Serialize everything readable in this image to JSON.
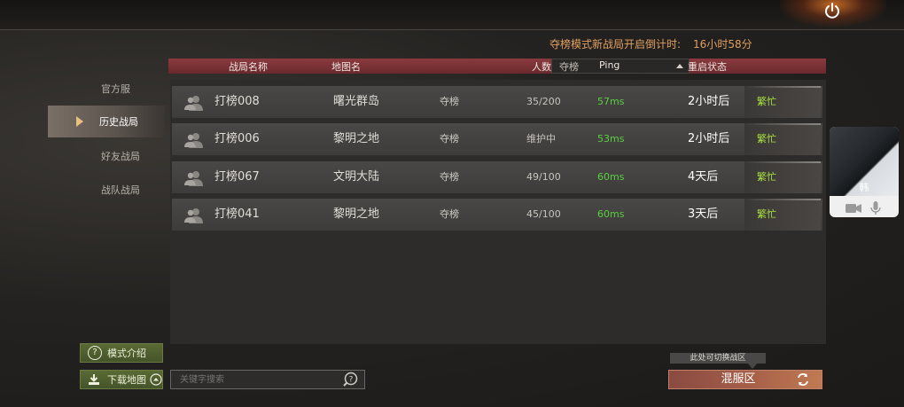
{
  "countdown": {
    "label": "夺榜模式新战局开启倒计时:",
    "value": "16小时58分"
  },
  "table_header": {
    "name": "战局名称",
    "map": "地图名",
    "mode_filter": "夺榜",
    "players": "人数",
    "ping": "Ping",
    "restart": "重启状态"
  },
  "sidebar": {
    "items": [
      {
        "label": "官方服",
        "active": false
      },
      {
        "label": "历史战局",
        "active": true
      },
      {
        "label": "好友战局",
        "active": false
      },
      {
        "label": "战队战局",
        "active": false
      }
    ]
  },
  "rows": [
    {
      "name": "打榜008",
      "map": "曙光群岛",
      "mode": "夺榜",
      "players": "35/200",
      "ping": "57ms",
      "restart": "2小时后",
      "status": "繁忙"
    },
    {
      "name": "打榜006",
      "map": "黎明之地",
      "mode": "夺榜",
      "players": "维护中",
      "ping": "53ms",
      "restart": "2小时后",
      "status": "繁忙"
    },
    {
      "name": "打榜067",
      "map": "文明大陆",
      "mode": "夺榜",
      "players": "49/100",
      "ping": "60ms",
      "restart": "4天后",
      "status": "繁忙"
    },
    {
      "name": "打榜041",
      "map": "黎明之地",
      "mode": "夺榜",
      "players": "45/100",
      "ping": "60ms",
      "restart": "3天后",
      "status": "繁忙"
    }
  ],
  "buttons": {
    "mode_intro": "模式介绍",
    "download_map": "下载地图",
    "server_zone": "混服区"
  },
  "search": {
    "placeholder": "关键字搜索"
  },
  "hint": "此处可切换战区",
  "video_call": {
    "name": "韩"
  },
  "colors": {
    "header_red": "#7a3236",
    "ping_green": "#58d040",
    "status_yellowgreen": "#a8e040",
    "countdown_orange": "#e0a060",
    "button_green": "#4e5e2e",
    "server_btn": "#a45e48"
  },
  "icons": [
    "power-icon",
    "user-icon",
    "question-icon",
    "download-icon",
    "up-arrow-icon",
    "search-question-icon",
    "refresh-icon",
    "camera-icon",
    "microphone-icon",
    "sort-up-icon",
    "play-triangle-icon"
  ]
}
